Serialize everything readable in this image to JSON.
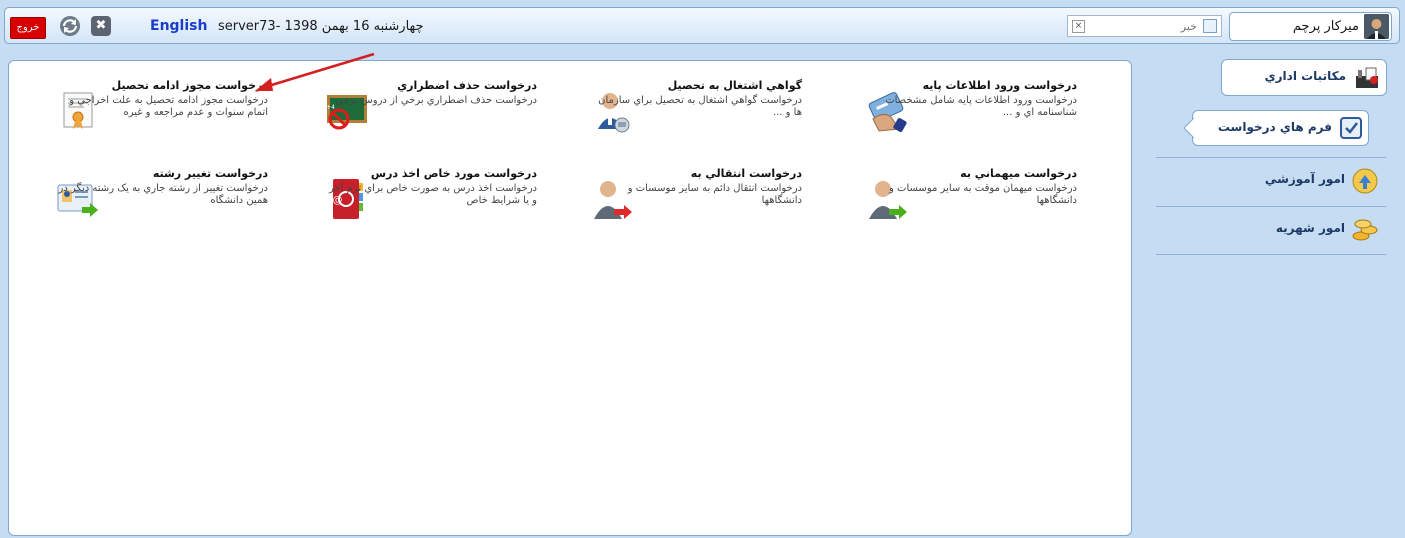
{
  "header": {
    "exit_label": "خروج",
    "language_link": "English",
    "date_text": "چهارشنبه 16 بهمن 1398 -server73",
    "search_placeholder": "خبر",
    "search_clear": "×",
    "close_symbol": "✖",
    "user_name": "میرکار پرچم"
  },
  "cards": [
    {
      "title": "درخواست ورود اطلاعات پایه",
      "desc": "درخواست ورود اطلاعات پایه شامل مشخصات شناسنامه اي و ...",
      "icon": "hand-card-icon"
    },
    {
      "title": "گواهي اشتغال به تحصيل",
      "desc": "درخواست گواهي اشتغال به تحصيل براي سازمان ها و ...",
      "icon": "student-certificate-icon"
    },
    {
      "title": "درخواست حذف اضطراري",
      "desc": "درخواست حذف اضطراري برخي از دروس ترمي",
      "icon": "blackboard-delete-icon"
    },
    {
      "title": "درخواست مجوز ادامه تحصيل",
      "desc": "درخواست مجوز ادامه تحصيل به علت اخراجي و اتمام سنوات و عدم مراجعه و غيره",
      "icon": "certificate-icon"
    },
    {
      "title": "درخواست ميهماني به",
      "desc": "درخواست ميهمان موقت به ساير موسسات و دانشگاهها",
      "icon": "person-arrow-icon"
    },
    {
      "title": "درخواست انتقالي به",
      "desc": "درخواست انتقال دائم به ساير موسسات و دانشگاهها",
      "icon": "person-red-arrow-icon"
    },
    {
      "title": "درخواست مورد خاص اخذ درس",
      "desc": "درخواست اخذ درس به صورت خاص براي ترم آخر و يا شرايط خاص",
      "icon": "address-book-icon"
    },
    {
      "title": "درخواست تغيير رشته",
      "desc": "درخواست تغيير از رشته جاري به يک رشته ديگر در همين دانشگاه",
      "icon": "id-card-arrow-icon"
    }
  ],
  "sidebar": {
    "items": [
      {
        "label": "مکاتبات اداري",
        "icon": "office-letters-icon"
      },
      {
        "label": "فرم هاي درخواست",
        "icon": "request-form-icon"
      },
      {
        "label": "امور آموزشي",
        "icon": "education-icon"
      },
      {
        "label": "امور شهريه",
        "icon": "tuition-coins-icon"
      }
    ]
  },
  "colors": {
    "accent": "#1b3a66",
    "exit": "#d80000",
    "background": "#c5dcf2"
  }
}
